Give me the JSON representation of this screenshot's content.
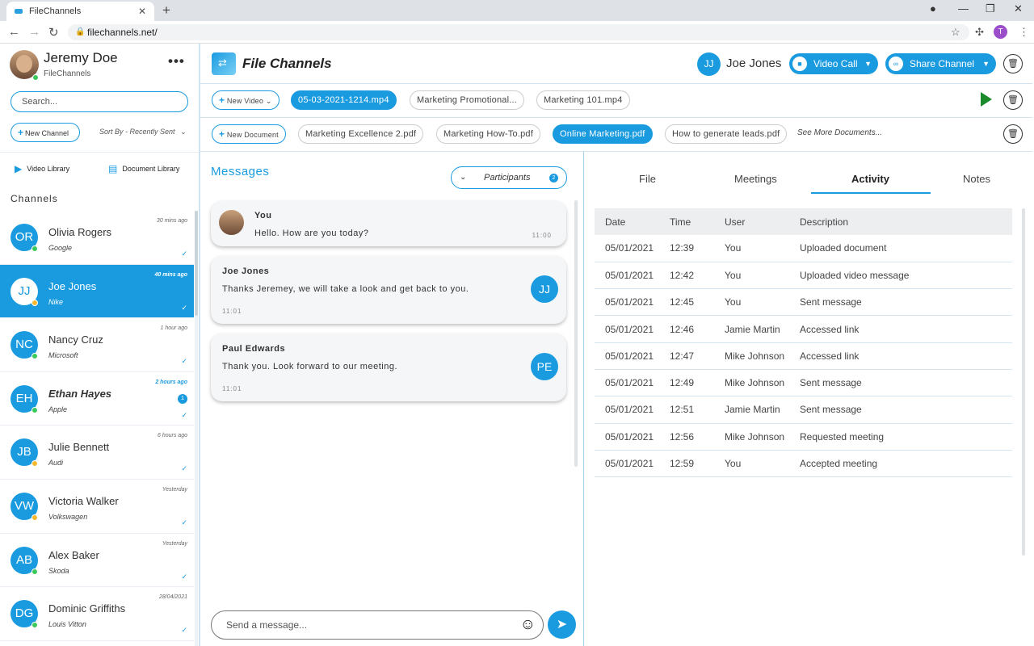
{
  "browser": {
    "tab_title": "FileChannels",
    "url": "filechannels.net/",
    "new_tab": "+",
    "profile_initial": "T"
  },
  "user": {
    "name": "Jeremy Doe",
    "org": "FileChannels",
    "more": "•••"
  },
  "sidebar": {
    "search_placeholder": "Search...",
    "new_channel": "New Channel",
    "sort_by": "Sort By - Recently Sent",
    "video_library": "Video Library",
    "document_library": "Document Library",
    "channels_heading": "Channels",
    "channels": [
      {
        "initials": "OR",
        "name": "Olivia Rogers",
        "org": "Google",
        "time": "30 mins ago",
        "status": "#3cc85a",
        "check": "✓",
        "badge": ""
      },
      {
        "initials": "JJ",
        "name": "Joe Jones",
        "org": "Nike",
        "time": "40 mins ago",
        "status": "#f5b82e",
        "check": "✓",
        "badge": ""
      },
      {
        "initials": "NC",
        "name": "Nancy Cruz",
        "org": "Microsoft",
        "time": "1 hour ago",
        "status": "#3cc85a",
        "check": "✓",
        "badge": ""
      },
      {
        "initials": "EH",
        "name": "Ethan Hayes",
        "org": "Apple",
        "time": "2 hours ago",
        "status": "#3cc85a",
        "check": "✓",
        "badge": "1"
      },
      {
        "initials": "JB",
        "name": "Julie Bennett",
        "org": "Audi",
        "time": "6 hours ago",
        "status": "#f5b82e",
        "check": "✓",
        "badge": ""
      },
      {
        "initials": "VW",
        "name": "Victoria Walker",
        "org": "Volkswagen",
        "time": "Yesterday",
        "status": "#f5b82e",
        "check": "✓",
        "badge": ""
      },
      {
        "initials": "AB",
        "name": "Alex Baker",
        "org": "Skoda",
        "time": "Yesterday",
        "status": "#3cc85a",
        "check": "✓",
        "badge": ""
      },
      {
        "initials": "DG",
        "name": "Dominic Griffiths",
        "org": "Louis Vitton",
        "time": "28/04/2021",
        "status": "#3cc85a",
        "check": "✓",
        "badge": ""
      }
    ]
  },
  "header": {
    "app_name": "File Channels",
    "contact_initials": "JJ",
    "contact_name": "Joe Jones",
    "video_call": "Video Call",
    "share_channel": "Share Channel"
  },
  "videos": {
    "new_label": "New Video",
    "files": [
      "05-03-2021-1214.mp4",
      "Marketing Promotional...",
      "Marketing 101.mp4"
    ]
  },
  "documents": {
    "new_label": "New Document",
    "files": [
      "Marketing Excellence 2.pdf",
      "Marketing How-To.pdf",
      "Online Marketing.pdf",
      "How to generate leads.pdf"
    ],
    "see_more": "See More Documents..."
  },
  "messages": {
    "heading": "Messages",
    "participants_label": "Participants",
    "participants_count": "2",
    "items": [
      {
        "from": "You",
        "text": "Hello. How are you today?",
        "time": "11:00",
        "initials": ""
      },
      {
        "from": "Joe Jones",
        "text": "Thanks Jeremey, we will take a look and get back to you.",
        "time": "11:01",
        "initials": "JJ"
      },
      {
        "from": "Paul Edwards",
        "text": "Thank you. Look forward to our meeting.",
        "time": "11:01",
        "initials": "PE"
      }
    ],
    "compose_placeholder": "Send a message..."
  },
  "activity": {
    "tabs": [
      "File",
      "Meetings",
      "Activity",
      "Notes"
    ],
    "active_tab": "Activity",
    "columns": [
      "Date",
      "Time",
      "User",
      "Description"
    ],
    "rows": [
      [
        "05/01/2021",
        "12:39",
        "You",
        "Uploaded document"
      ],
      [
        "05/01/2021",
        "12:42",
        "You",
        "Uploaded video message"
      ],
      [
        "05/01/2021",
        "12:45",
        "You",
        "Sent message"
      ],
      [
        "05/01/2021",
        "12:46",
        "Jamie Martin",
        "Accessed link"
      ],
      [
        "05/01/2021",
        "12:47",
        "Mike Johnson",
        "Accessed link"
      ],
      [
        "05/01/2021",
        "12:49",
        "Mike Johnson",
        "Sent message"
      ],
      [
        "05/01/2021",
        "12:51",
        "Jamie Martin",
        "Sent message"
      ],
      [
        "05/01/2021",
        "12:56",
        "Mike Johnson",
        "Requested meeting"
      ],
      [
        "05/01/2021",
        "12:59",
        "You",
        "Accepted meeting"
      ]
    ]
  },
  "colors": {
    "accent": "#1a9be0",
    "online": "#3cc85a",
    "away": "#f5b82e",
    "play": "#1a8a2a"
  }
}
